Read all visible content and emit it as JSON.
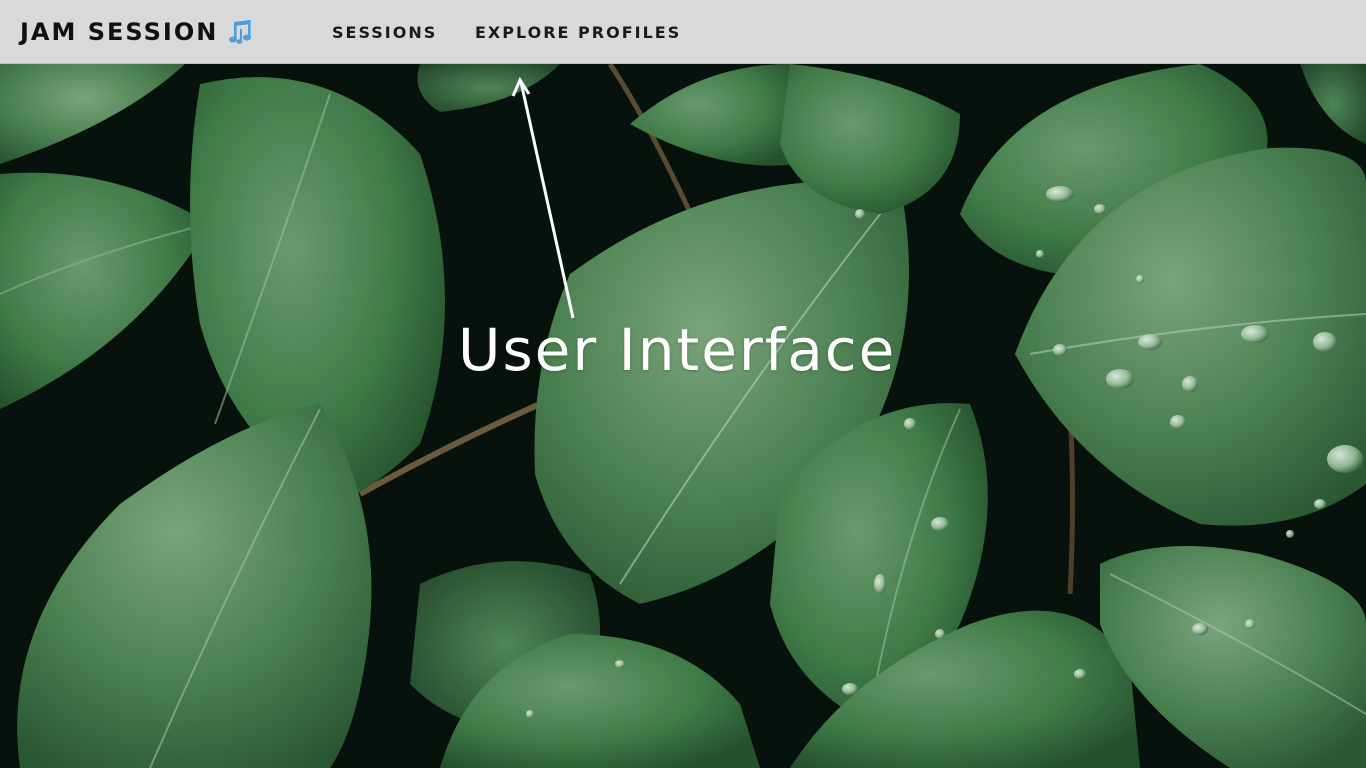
{
  "navbar": {
    "brand_title": "JAM SESSION",
    "brand_icon": "music-notes-icon",
    "links": [
      {
        "label": "SESSIONS"
      },
      {
        "label": "EXPLORE PROFILES"
      }
    ]
  },
  "hero": {
    "title": "User Interface",
    "background": "green-leaves-with-water-droplets"
  },
  "colors": {
    "navbar_bg": "#d9d9d9",
    "brand_icon": "#4a9fe0",
    "hero_text": "#ffffff",
    "leaf_green": "#3f7a47",
    "dark_bg": "#0b1410"
  }
}
